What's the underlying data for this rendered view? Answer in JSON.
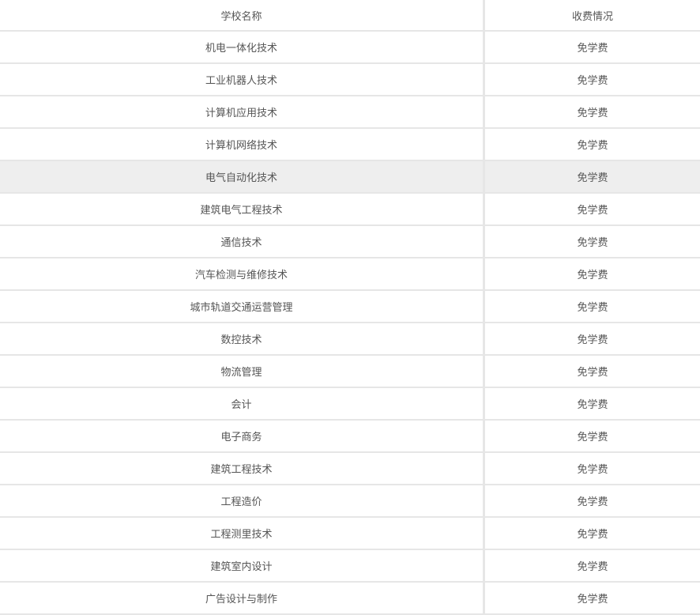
{
  "table": {
    "headers": {
      "name": "学校名称",
      "fee": "收费情况"
    },
    "rows": [
      {
        "name": "机电一体化技术",
        "fee": "免学费"
      },
      {
        "name": "工业机器人技术",
        "fee": "免学费"
      },
      {
        "name": "计算机应用技术",
        "fee": "免学费"
      },
      {
        "name": "计算机网络技术",
        "fee": "免学费"
      },
      {
        "name": "电气自动化技术",
        "fee": "免学费",
        "highlighted": true
      },
      {
        "name": "建筑电气工程技术",
        "fee": "免学费"
      },
      {
        "name": "通信技术",
        "fee": "免学费"
      },
      {
        "name": "汽车检测与维修技术",
        "fee": "免学费"
      },
      {
        "name": "城市轨道交通运营管理",
        "fee": "免学费"
      },
      {
        "name": "数控技术",
        "fee": "免学费"
      },
      {
        "name": "物流管理",
        "fee": "免学费"
      },
      {
        "name": "会计",
        "fee": "免学费"
      },
      {
        "name": "电子商务",
        "fee": "免学费"
      },
      {
        "name": "建筑工程技术",
        "fee": "免学费"
      },
      {
        "name": "工程造价",
        "fee": "免学费"
      },
      {
        "name": "工程测里技术",
        "fee": "免学费"
      },
      {
        "name": "建筑室内设计",
        "fee": "免学费"
      },
      {
        "name": "广告设计与制作",
        "fee": "免学费"
      }
    ]
  }
}
